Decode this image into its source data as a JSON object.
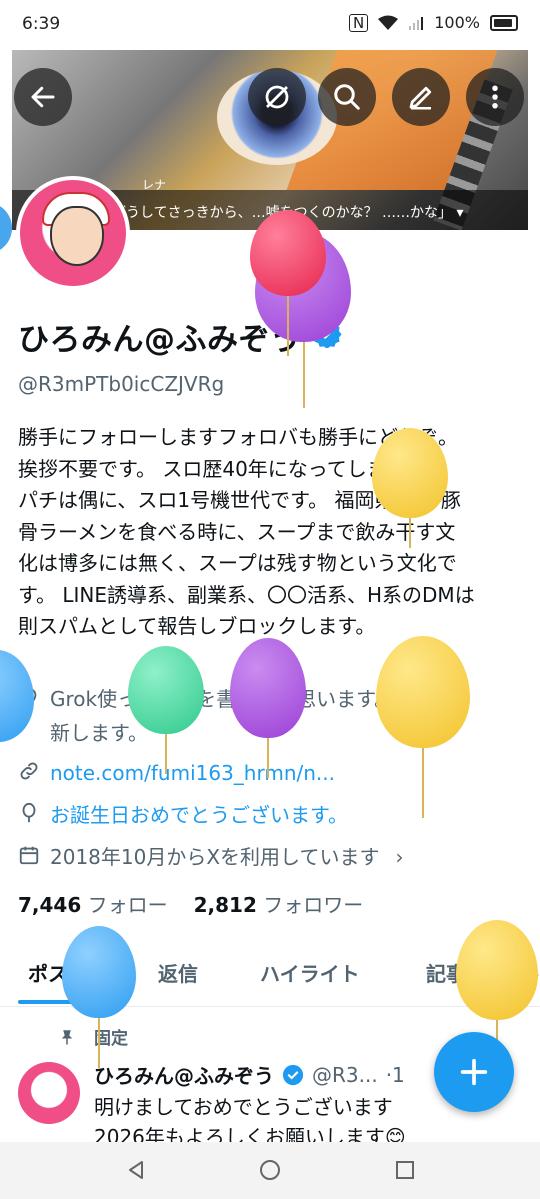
{
  "status_bar": {
    "time": "6:39",
    "battery": "100%"
  },
  "banner": {
    "speaker": "レナ",
    "caption": "どうしてさっきから、…嘘をつくのかな？ ……かな」 ▾"
  },
  "profile": {
    "display_name": "ひろみん@ふみぞう",
    "handle": "@R3mPTb0icCZJVRg",
    "bio_lines": [
      "勝手にフォローしますフォロバも勝手にどうぞ。",
      "挨拶不要です。 スロ歴40年になってしまった、",
      "パチは偶に、スロ1号機世代です。 福岡県出身 豚",
      "骨ラーメンを食べる時に、スープまで飲み干す文",
      "化は博多には無く、スープは残す物という文化で",
      "す。 LINE誘導系、副業系、〇〇活系、H系のDMは",
      "則スパムとして報告しブロックします。"
    ],
    "location_line1": "Grok使って小説を書こうと思います。週一更",
    "location_line2": "新します。",
    "link": "note.com/fumi163_hrmn/n...",
    "birthday": "お誕生日おめでとうございます。",
    "joined": "2018年10月からXを利用しています",
    "following_count": "7,446",
    "following_label": "フォロー",
    "followers_count": "2,812",
    "followers_label": "フォロワー"
  },
  "tabs": [
    "ポスト",
    "返信",
    "ハイライト",
    "記事"
  ],
  "pinned_label": "固定",
  "tweet": {
    "name": "ひろみん@ふみぞう",
    "handle": "@R3...",
    "time": "·1",
    "line1": "明けましておめでとうございます",
    "line2": "2026年もよろしくお願いします😊"
  },
  "colors": {
    "accent": "#1d9bf0",
    "text": "#0f1419",
    "secondary": "#536471"
  }
}
